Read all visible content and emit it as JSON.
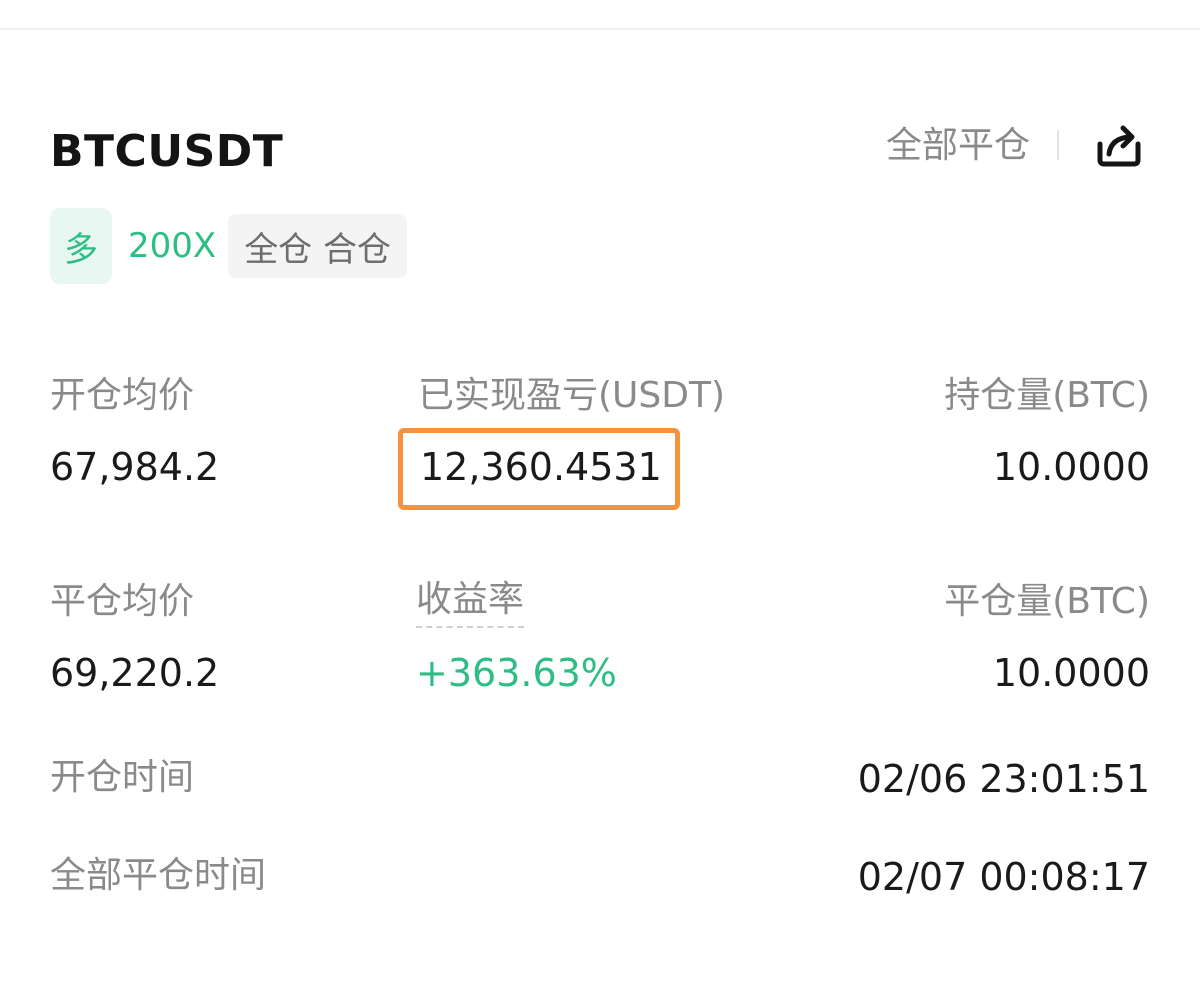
{
  "header": {
    "symbol": "BTCUSDT",
    "close_all_label": "全部平仓",
    "share_icon": "share-icon"
  },
  "tags": {
    "side": "多",
    "leverage": "200X",
    "margin_mode": "全仓 合仓"
  },
  "stats": {
    "open_avg_price_label": "开仓均价",
    "open_avg_price": "67,984.2",
    "realized_pnl_label": "已实现盈亏(USDT)",
    "realized_pnl": "12,360.4531",
    "position_size_label": "持仓量(BTC)",
    "position_size": "10.0000",
    "close_avg_price_label": "平仓均价",
    "close_avg_price": "69,220.2",
    "roi_label": "收益率",
    "roi": "+363.63%",
    "closed_size_label": "平仓量(BTC)",
    "closed_size": "10.0000",
    "open_time_label": "开仓时间",
    "open_time": "02/06 23:01:51",
    "close_time_label": "全部平仓时间",
    "close_time": "02/07 00:08:17"
  },
  "colors": {
    "accent_green": "#2ebd85",
    "highlight_orange": "#f5923e",
    "label_gray": "#8a8a8a"
  }
}
